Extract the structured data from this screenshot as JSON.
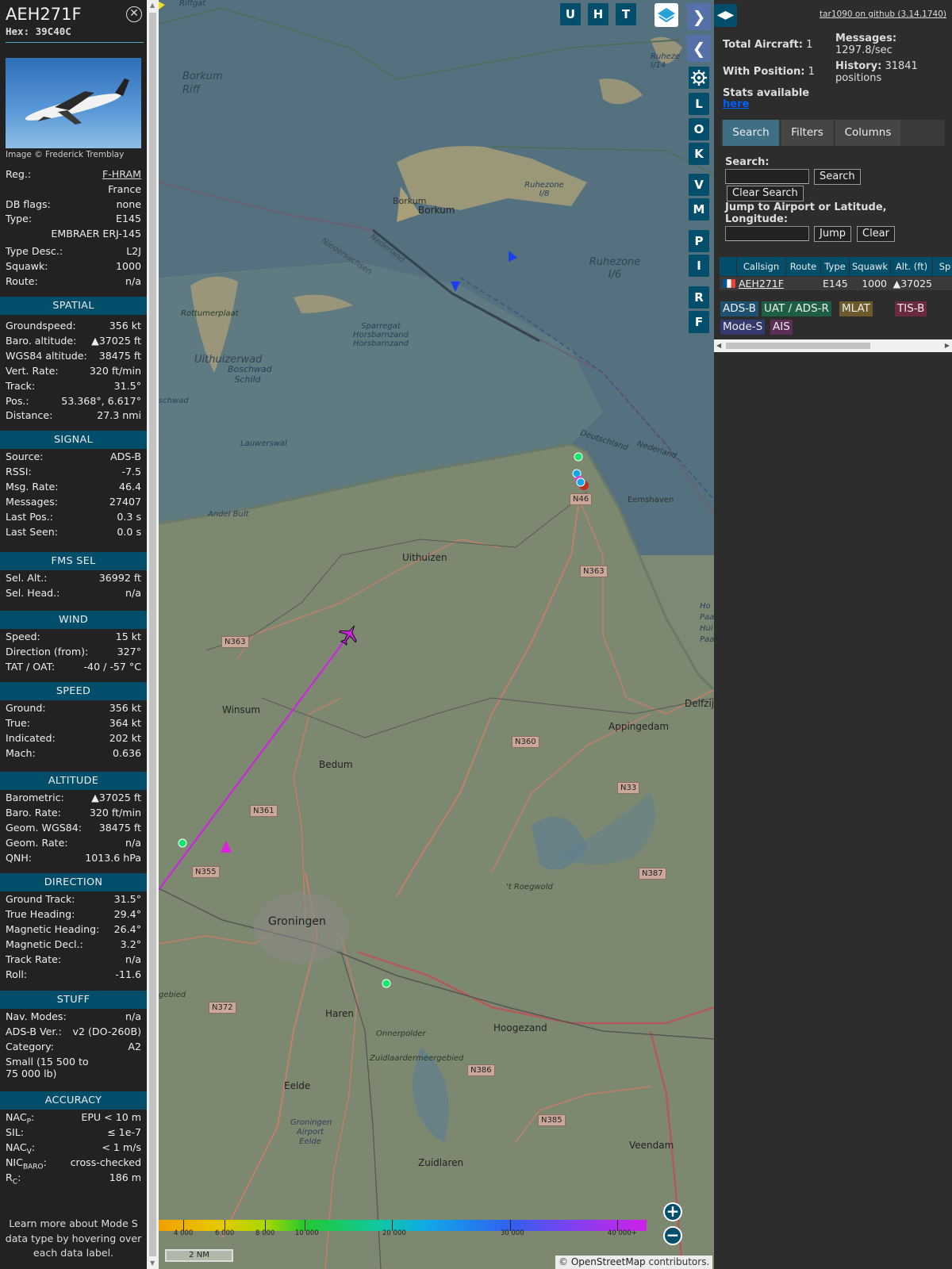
{
  "info": {
    "callsign": "AEH271F",
    "hex_label": "Hex: 39C40C",
    "photo_credit": "Image © Frederick Tremblay",
    "reg_label": "Reg.:",
    "reg_value": "F-HRAM",
    "country": "France",
    "dbflags_label": "DB flags:",
    "dbflags_value": "none",
    "type_label": "Type:",
    "type_value": "E145",
    "type_name": "EMBRAER ERJ-145",
    "typedesc_label": "Type Desc.:",
    "typedesc_value": "L2J",
    "squawk_label": "Squawk:",
    "squawk_value": "1000",
    "route_label": "Route:",
    "route_value": "n/a",
    "footer": "Learn more about Mode S data type by hovering over each data label."
  },
  "sections": {
    "spatial": {
      "title": "SPATIAL",
      "rows": [
        {
          "k": "Groundspeed:",
          "v": "356 kt"
        },
        {
          "k": "Baro. altitude:",
          "v": "▲37025 ft"
        },
        {
          "k": "WGS84 altitude:",
          "v": "38475 ft"
        },
        {
          "k": "Vert. Rate:",
          "v": "320 ft/min"
        },
        {
          "k": "Track:",
          "v": "31.5°"
        },
        {
          "k": "Pos.:",
          "v": "53.368°, 6.617°"
        },
        {
          "k": "Distance:",
          "v": "27.3 nmi"
        }
      ]
    },
    "signal": {
      "title": "SIGNAL",
      "rows": [
        {
          "k": "Source:",
          "v": "ADS-B"
        },
        {
          "k": "RSSI:",
          "v": "-7.5"
        },
        {
          "k": "Msg. Rate:",
          "v": "46.4"
        },
        {
          "k": "Messages:",
          "v": "27407"
        },
        {
          "k": "Last Pos.:",
          "v": "0.3 s"
        },
        {
          "k": "Last Seen:",
          "v": "0.0 s"
        }
      ]
    },
    "fms": {
      "title": "FMS SEL",
      "rows": [
        {
          "k": "Sel. Alt.:",
          "v": "36992 ft"
        },
        {
          "k": "Sel. Head.:",
          "v": "n/a"
        }
      ]
    },
    "wind": {
      "title": "WIND",
      "rows": [
        {
          "k": "Speed:",
          "v": "15 kt"
        },
        {
          "k": "Direction (from):",
          "v": "327°"
        },
        {
          "k": "TAT / OAT:",
          "v": "-40 / -57 °C"
        }
      ]
    },
    "speed": {
      "title": "SPEED",
      "rows": [
        {
          "k": "Ground:",
          "v": "356 kt"
        },
        {
          "k": "True:",
          "v": "364 kt"
        },
        {
          "k": "Indicated:",
          "v": "202 kt"
        },
        {
          "k": "Mach:",
          "v": "0.636"
        }
      ]
    },
    "altitude": {
      "title": "ALTITUDE",
      "rows": [
        {
          "k": "Barometric:",
          "v": "▲37025 ft"
        },
        {
          "k": "Baro. Rate:",
          "v": "320 ft/min"
        },
        {
          "k": "Geom. WGS84:",
          "v": "38475 ft"
        },
        {
          "k": "Geom. Rate:",
          "v": "n/a"
        },
        {
          "k": "QNH:",
          "v": "1013.6 hPa"
        }
      ]
    },
    "direction": {
      "title": "DIRECTION",
      "rows": [
        {
          "k": "Ground Track:",
          "v": "31.5°"
        },
        {
          "k": "True Heading:",
          "v": "29.4°"
        },
        {
          "k": "Magnetic Heading:",
          "v": "26.4°"
        },
        {
          "k": "Magnetic Decl.:",
          "v": "3.2°"
        },
        {
          "k": "Track Rate:",
          "v": "n/a"
        },
        {
          "k": "Roll:",
          "v": "-11.6"
        }
      ]
    },
    "stuff": {
      "title": "STUFF",
      "rows": [
        {
          "k": "Nav. Modes:",
          "v": "n/a"
        },
        {
          "k": "ADS-B Ver.:",
          "v": "v2 (DO-260B)"
        },
        {
          "k": "Category:",
          "v": "A2"
        }
      ],
      "category_desc": "Small (15 500 to 75 000 lb)"
    },
    "accuracy": {
      "title": "ACCURACY",
      "rows": [
        {
          "k": "NACP:",
          "v": "EPU < 10 m"
        },
        {
          "k": "SIL:",
          "v": "≤ 1e-7"
        },
        {
          "k": "NACV:",
          "v": "< 1 m/s"
        },
        {
          "k": "NICBARO:",
          "v": "cross-checked"
        },
        {
          "k": "RC:",
          "v": "186 m"
        }
      ]
    }
  },
  "map": {
    "labels": {
      "riffgat": "Riffgat",
      "borkum_riff": "Borkum Riff",
      "borkum": "Borkum",
      "borkum_town": "Borkum",
      "ruhezone18": "Ruhezone I/8",
      "ruhezone16": "Ruhezone I/6",
      "ruhezone_top": "Ruheze I/14",
      "nedersaksen": "Niedersachsen",
      "nederland1": "Nederland",
      "rottumerplaat": "Rottumerplaat",
      "sparregat": "Sparregat Horsbarnzand Horsbarnzand",
      "uithuizerwad": "Uithuizerwad",
      "boschwad": "Boschwad Schild",
      "schwad": "schwad",
      "lauwerswal": "Lauwerswal",
      "andel_bult": "Andel Bult",
      "deutschland": "Deutschland",
      "nederland2": "Nederland",
      "eemshaven": "Eemshaven",
      "uithuizen": "Uithuizen",
      "winsum": "Winsum",
      "bedum": "Bedum",
      "delfzijl": "Delfzijl",
      "appingedam": "Appingedam",
      "groningen": "Groningen",
      "roegwold": "'t Roegwold",
      "haren": "Haren",
      "hoogezand": "Hoogezand",
      "onnerpolder": "Onnerpolder",
      "zuidlaardermeer": "Zuidlaardermeergebied",
      "eelde": "Eelde",
      "gae": "Groningen Airport Eelde",
      "zuidlaren": "Zuidlaren",
      "veendam": "Veendam",
      "gebied": "gebied",
      "hpa": "Ho Paa Hui Paa"
    },
    "roads": {
      "n46": "N46",
      "n363a": "N363",
      "n363b": "N363",
      "n360": "N360",
      "n33": "N33",
      "n361": "N361",
      "n355": "N355",
      "n387": "N387",
      "n372": "N372",
      "n386": "N386",
      "n385": "N385"
    },
    "buttons": {
      "u": "U",
      "h": "H",
      "t": "T",
      "l": "L",
      "o": "O",
      "k": "K",
      "v": "V",
      "m": "M",
      "p": "P",
      "i": "I",
      "r": "R",
      "f": "F",
      "forward": "❯",
      "back": "❮",
      "zoom_in": "+",
      "zoom_out": "−"
    },
    "altitude_ticks": [
      "4 000",
      "6 000",
      "8 000",
      "10 000",
      "20 000",
      "30 000",
      "40 000+"
    ],
    "scale": "2 NM",
    "attribution_prefix": "© ",
    "attribution_link": "OpenStreetMap",
    "attribution_suffix": " contributors."
  },
  "sidebar": {
    "github": "tar1090 on github (3.14.1740)",
    "total_aircraft_label": "Total Aircraft:",
    "total_aircraft": "1",
    "with_position_label": "With Position:",
    "with_position": "1",
    "messages_label": "Messages:",
    "messages_value": "1297.8/sec",
    "history_label": "History:",
    "history_value": "31841",
    "history_unit": "positions",
    "stats_text": "Stats available",
    "stats_link": "here",
    "tabs": [
      "Search",
      "Filters",
      "Columns"
    ],
    "search_label": "Search:",
    "search_button": "Search",
    "clear_search_button": "Clear Search",
    "jump_label": "Jump to Airport or Latitude, Longitude:",
    "jump_button": "Jump",
    "clear_button": "Clear",
    "columns": [
      "Callsign",
      "Route",
      "Type",
      "Squawk",
      "Alt. (ft)",
      "Sp"
    ],
    "row": {
      "callsign": "AEH271F",
      "route": "",
      "type": "E145",
      "squawk": "1000",
      "alt": "▲37025"
    },
    "legend": [
      {
        "label": "ADS-B",
        "color": "#1e5071"
      },
      {
        "label": "UAT / ADS-R",
        "color": "#1e5e44"
      },
      {
        "label": "MLAT",
        "color": "#6c5a2c"
      },
      {
        "label": "TIS-B",
        "color": "#6c2a40"
      },
      {
        "label": "Mode-S",
        "color": "#343a6e"
      },
      {
        "label": "AIS",
        "color": "#5c2e55"
      }
    ]
  }
}
